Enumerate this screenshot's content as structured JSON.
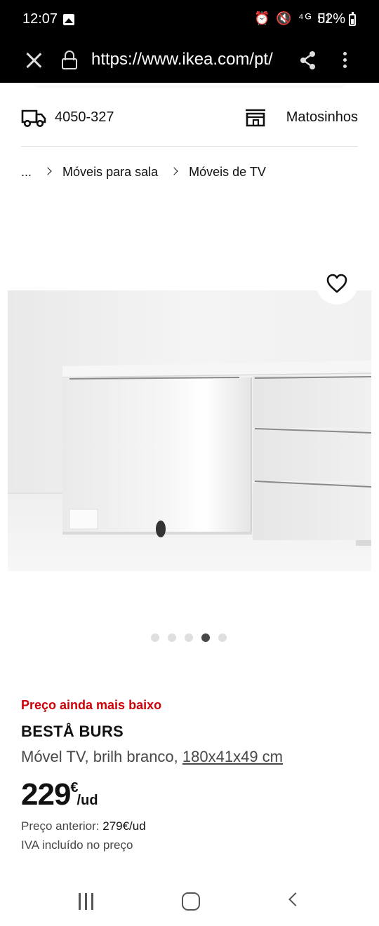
{
  "status_bar": {
    "time": "12:07",
    "icons": "⏰ 🔇 ⁴ᴳ ıll",
    "battery": "52%"
  },
  "browser": {
    "url": "https://www.ikea.com/pt/"
  },
  "delivery": {
    "postcode": "4050-327",
    "store": "Matosinhos"
  },
  "breadcrumb": {
    "ellipsis": "...",
    "items": [
      "Móveis para sala",
      "Móveis de TV"
    ]
  },
  "carousel": {
    "count": 5,
    "active_index": 3
  },
  "product": {
    "promo": "Preço ainda mais baixo",
    "name": "BESTÅ BURS",
    "description": "Móvel TV, brilh branco, ",
    "dimensions": "180x41x49 cm",
    "price_integer": "229",
    "price_currency": "€",
    "price_unit": "/ud",
    "previous_price_label": "Preço anterior: ",
    "previous_price_value": "279€/ud",
    "vat_note": "IVA incluído no preço"
  },
  "colors": {
    "promo_red": "#cc0008",
    "text": "#111111",
    "secondary_text": "#484848"
  }
}
